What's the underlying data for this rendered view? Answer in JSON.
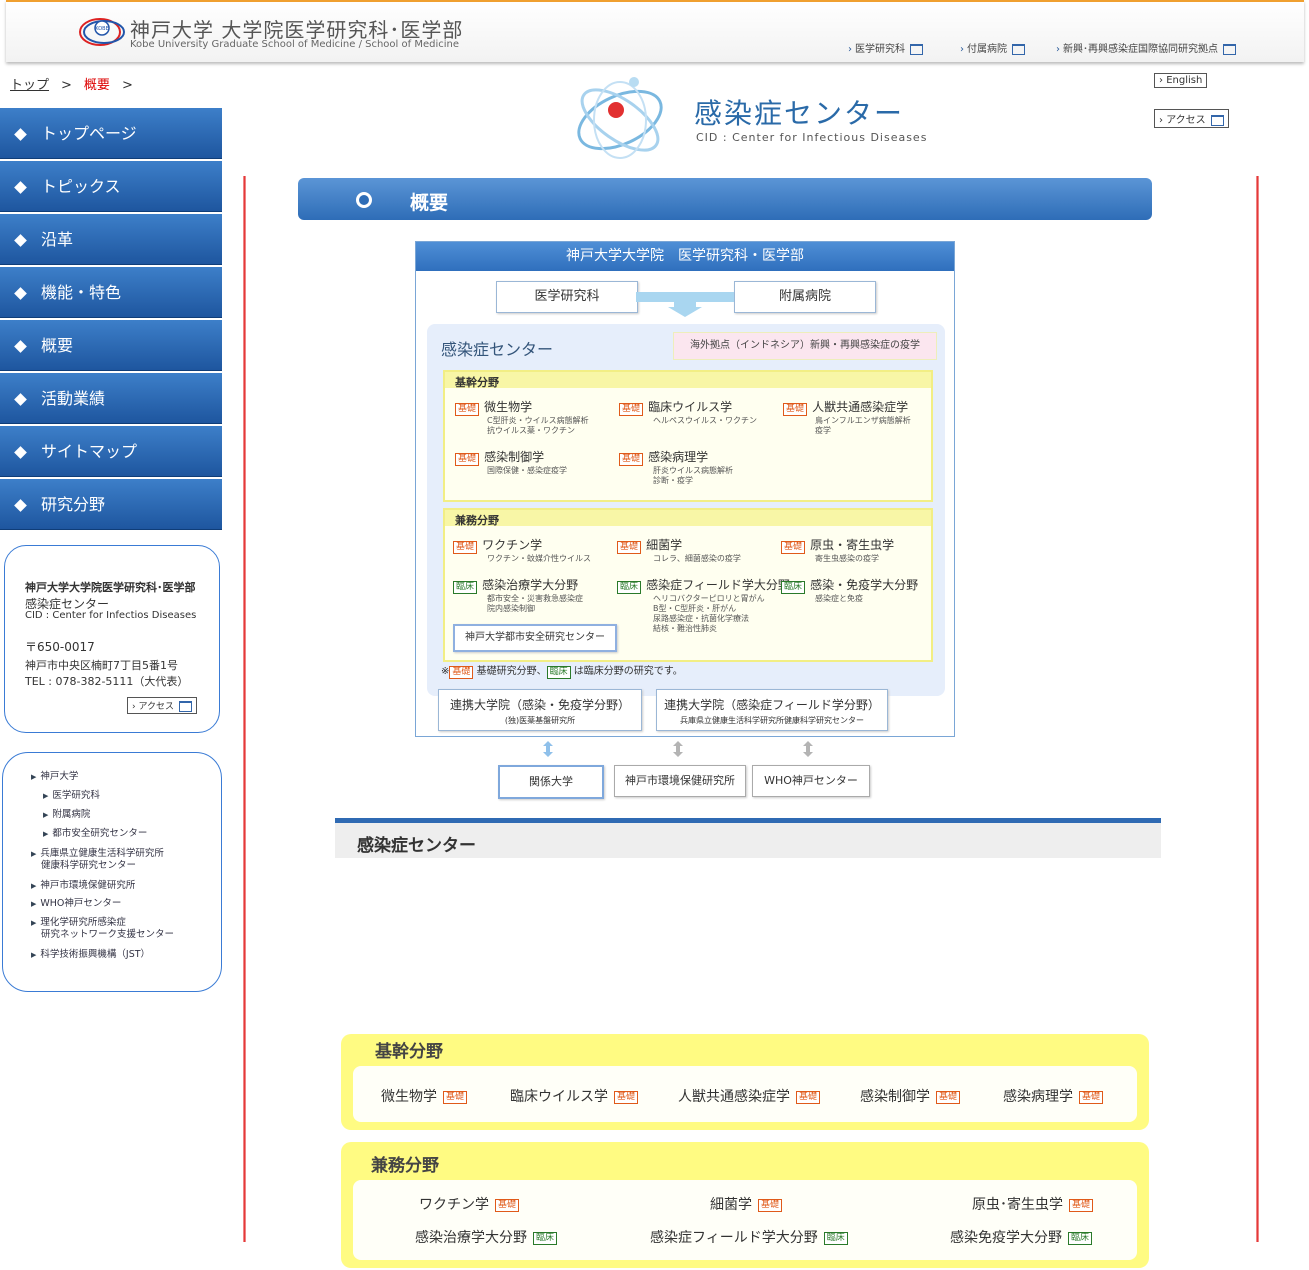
{
  "header": {
    "site_title": "神戸大学 大学院医学研究科･医学部",
    "site_subtitle": "Kobe University Graduate School of Medicine / School of Medicine",
    "logo_text": "KOBE",
    "links": [
      "医学研究科",
      "付属病院",
      "新興･再興感染症国際協同研究拠点"
    ]
  },
  "breadcrumb": {
    "top": "トップ",
    "sep": ">",
    "current": "概要"
  },
  "cid": {
    "title": "感染症センター",
    "subtitle": "CID : Center for Infectious Diseases"
  },
  "buttons": {
    "english": "English",
    "access": "アクセス"
  },
  "sidenav": [
    "トップページ",
    "トピックス",
    "沿革",
    "機能・特色",
    "概要",
    "活動業績",
    "サイトマップ",
    "研究分野"
  ],
  "info": {
    "org": "神戸大学大学院医学研究科･医学部",
    "name": "感染症センター",
    "en": "CID : Center for Infectios Diseases",
    "zip": "〒650-0017",
    "address": "神戸市中央区楠町7丁目5番1号",
    "tel": "TEL : 078-382-5111（大代表）",
    "access": "アクセス"
  },
  "links": [
    "神戸大学",
    "医学研究科",
    "附属病院",
    "都市安全研究センター",
    "兵庫県立健康生活科学研究所",
    "健康科学研究センター",
    "神戸市環境保健研究所",
    "WHO神戸センター",
    "理化学研究所感染症",
    "研究ネットワーク支援センター",
    "科学技術振興機構（JST）"
  ],
  "section_title": "概要",
  "org": {
    "head": "神戸大学大学院　医学研究科・医学部",
    "grad": "医学研究科",
    "hospital": "附属病院",
    "center": "感染症センター",
    "overseas": "海外拠点（インドネシア）新興・再興感染症の疫学",
    "core_label": "基幹分野",
    "core": [
      {
        "tag": "基礎",
        "name": "微生物学",
        "desc": [
          "C型肝炎・ウイルス病態解析",
          "抗ウイルス薬・ワクチン"
        ]
      },
      {
        "tag": "基礎",
        "name": "臨床ウイルス学",
        "desc": [
          "ヘルペスウイルス・ワクチン"
        ]
      },
      {
        "tag": "基礎",
        "name": "人獣共通感染症学",
        "desc": [
          "鳥インフルエンザ病態解析",
          "疫学"
        ]
      },
      {
        "tag": "基礎",
        "name": "感染制御学",
        "desc": [
          "国際保健・感染症疫学"
        ]
      },
      {
        "tag": "基礎",
        "name": "感染病理学",
        "desc": [
          "肝炎ウイルス病態解析",
          "診断・疫学"
        ]
      }
    ],
    "joint_label": "兼務分野",
    "joint": [
      {
        "tag": "基礎",
        "name": "ワクチン学",
        "desc": [
          "ワクチン・蚊媒介性ウイルス"
        ]
      },
      {
        "tag": "基礎",
        "name": "細菌学",
        "desc": [
          "コレラ、細菌感染の疫学"
        ]
      },
      {
        "tag": "基礎",
        "name": "原虫・寄生虫学",
        "desc": [
          "寄生虫感染の疫学"
        ]
      },
      {
        "tag": "臨床",
        "name": "感染治療学大分野",
        "desc": [
          "都市安全・災害救急感染症",
          "院内感染制御"
        ]
      },
      {
        "tag": "臨床",
        "name": "感染症フィールド学大分野",
        "desc": [
          "ヘリコバクターピロリと胃がん",
          "B型・C型肝炎・肝がん",
          "尿路感染症・抗菌化学療法",
          "結核・難治性肺炎"
        ]
      },
      {
        "tag": "臨床",
        "name": "感染・免疫学大分野",
        "desc": [
          "感染症と免疫"
        ]
      }
    ],
    "urban_center": "神戸大学都市安全研究センター",
    "note_prefix": "※",
    "note_tag1": "基礎",
    "note_mid": "基礎研究分野、",
    "note_tag2": "臨床",
    "note_end": "は臨床分野の研究です。",
    "partner1": {
      "title": "連携大学院（感染・免疫学分野）",
      "sub": "(独)医薬基盤研究所"
    },
    "partner2": {
      "title": "連携大学院（感染症フィールド学分野）",
      "sub": "兵庫県立健康生活科学研究所健康科学研究センター"
    },
    "related": [
      "関係大学",
      "神戸市環境保健研究所",
      "WHO神戸センター"
    ]
  },
  "center_heading": "感染症センター",
  "core_section": {
    "title": "基幹分野",
    "items": [
      {
        "name": "微生物学",
        "tag": "基礎"
      },
      {
        "name": "臨床ウイルス学",
        "tag": "基礎"
      },
      {
        "name": "人獣共通感染症学",
        "tag": "基礎"
      },
      {
        "name": "感染制御学",
        "tag": "基礎"
      },
      {
        "name": "感染病理学",
        "tag": "基礎"
      }
    ]
  },
  "joint_section": {
    "title": "兼務分野",
    "items": [
      {
        "name": "ワクチン学",
        "tag": "基礎"
      },
      {
        "name": "細菌学",
        "tag": "基礎"
      },
      {
        "name": "原虫･寄生虫学",
        "tag": "基礎"
      },
      {
        "name": "感染治療学大分野",
        "tag": "臨床"
      },
      {
        "name": "感染症フィールド学大分野",
        "tag": "臨床"
      },
      {
        "name": "感染免疫学大分野",
        "tag": "臨床"
      }
    ]
  },
  "colors": {
    "nav_blue": "#2a66b3",
    "accent_red": "#e02020",
    "tag_basic": "#e05a1a",
    "tag_clinical": "#2a7a2a",
    "yellow": "#fffb82"
  }
}
